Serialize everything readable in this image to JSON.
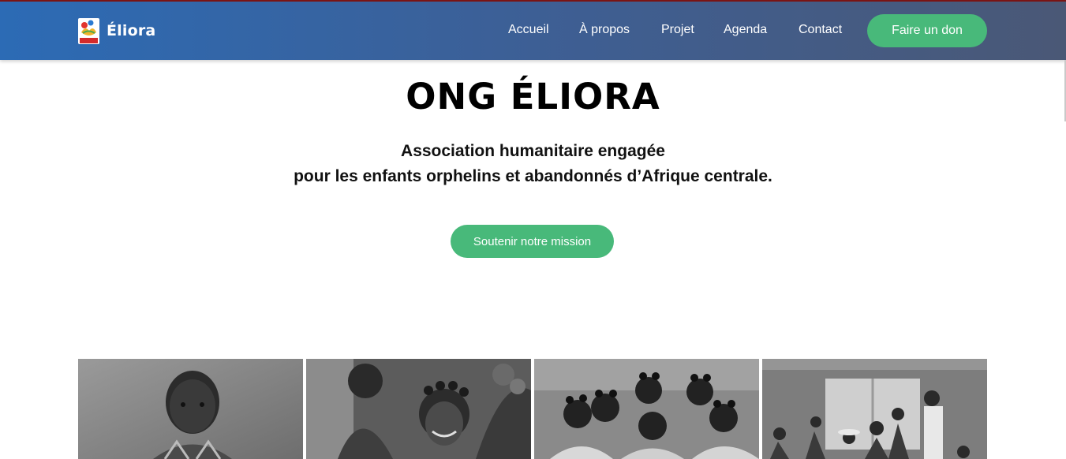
{
  "navbar": {
    "brand_name": "Éliora",
    "logo_text": "ELIORA",
    "links": [
      {
        "label": "Accueil"
      },
      {
        "label": "À propos"
      },
      {
        "label": "Projet"
      },
      {
        "label": "Agenda"
      },
      {
        "label": "Contact"
      }
    ],
    "donate_label": "Faire un don"
  },
  "hero": {
    "title": "ONG ÉLIORA",
    "subtitle_line1": "Association humanitaire engagée",
    "subtitle_line2": "pour les enfants orphelins et abandonnés d’Afrique centrale.",
    "cta_label": "Soutenir notre mission"
  },
  "gallery": {
    "photos": [
      {
        "subject": "child-portrait"
      },
      {
        "subject": "girls-with-flowers"
      },
      {
        "subject": "group-of-girls"
      },
      {
        "subject": "family-group-indoors"
      }
    ]
  },
  "colors": {
    "nav_gradient_start": "#2c6bb5",
    "nav_gradient_end": "#4a5876",
    "accent_green": "#48b97a"
  }
}
